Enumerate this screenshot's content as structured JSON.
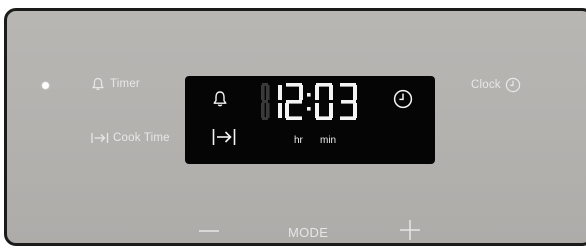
{
  "controls": {
    "timer_label": "Timer",
    "cook_time_label": "Cook Time",
    "clock_label": "Clock",
    "mode_label": "MODE"
  },
  "display": {
    "time": "12:03",
    "hours": "12",
    "minutes": "03",
    "hr_label": "hr",
    "min_label": "min"
  },
  "icons": {
    "timer": "bell-icon",
    "cook_time": "cook-time-icon",
    "clock": "clock-icon",
    "minus": "minus-icon",
    "plus": "plus-icon"
  },
  "colors": {
    "panel": "#b5b3b0",
    "panel_border": "#1b1b1b",
    "display_bg": "#050505",
    "display_segment_on": "#f4f4f4",
    "display_segment_off": "#3a3a3a",
    "label_text": "#e8e8e8"
  }
}
